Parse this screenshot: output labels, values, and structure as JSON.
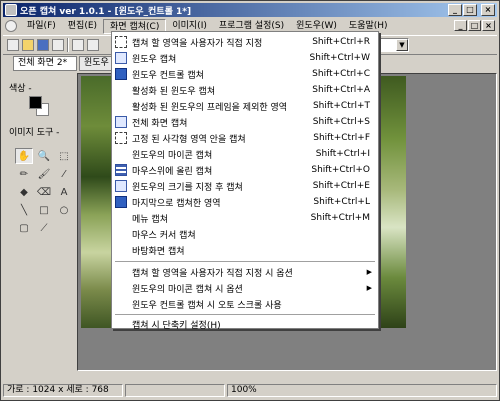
{
  "app": {
    "title": "오픈 캡쳐 ver 1.0.1 - [윈도우_컨트롤 1*]"
  },
  "window_buttons": [
    "_",
    "□",
    "×"
  ],
  "mdi_buttons": [
    "_",
    "□",
    "×"
  ],
  "menubar": {
    "items": [
      "파일(F)",
      "편집(E)",
      "화면 캡쳐(C)",
      "이미지(I)",
      "프로그램 설정(S)",
      "윈도우(W)",
      "도움말(H)"
    ],
    "active_index": 2
  },
  "tabs": [
    "전체 화면 2*",
    "윈도우 컨"
  ],
  "leftpanel": {
    "color_label": "색상 -",
    "tools_label": "이미지 도구 -"
  },
  "tools": [
    {
      "icon": "hand-icon",
      "glyph": "✋"
    },
    {
      "icon": "zoom-icon",
      "glyph": "🔍"
    },
    {
      "icon": "rect-select-icon",
      "glyph": "⬚"
    },
    {
      "icon": "pencil-icon",
      "glyph": "✏"
    },
    {
      "icon": "brush-icon",
      "glyph": "🖌"
    },
    {
      "icon": "eyedropper-icon",
      "glyph": "⁄"
    },
    {
      "icon": "fill-icon",
      "glyph": "◆"
    },
    {
      "icon": "eraser-icon",
      "glyph": "⌫"
    },
    {
      "icon": "text-icon",
      "glyph": "A"
    },
    {
      "icon": "line-icon",
      "glyph": "╲"
    },
    {
      "icon": "rectangle-icon",
      "glyph": "□"
    },
    {
      "icon": "ellipse-icon",
      "glyph": "○"
    },
    {
      "icon": "rounded-rect-icon",
      "glyph": "▢"
    },
    {
      "icon": "pen-icon",
      "glyph": "⟋"
    }
  ],
  "statusbar": {
    "size": "가로 : 1024 x 세로 : 768",
    "info": "",
    "zoom": "100%"
  },
  "dropdown": {
    "items": [
      {
        "label": "캡쳐 할 영역을 사용자가 직접 지정",
        "shortcut": "Shift+Ctrl+R",
        "icon": "area-select-icon"
      },
      {
        "label": "윈도우 캡쳐",
        "shortcut": "Shift+Ctrl+W",
        "icon": "window-capture-icon"
      },
      {
        "label": "윈도우 컨트롤 캡쳐",
        "shortcut": "Shift+Ctrl+C",
        "icon": "window-control-icon"
      },
      {
        "label": "활성화 된 윈도우 캡쳐",
        "shortcut": "Shift+Ctrl+A",
        "icon": ""
      },
      {
        "label": "활성화 된 윈도우의 프레임을 제외한 영역",
        "shortcut": "Shift+Ctrl+T",
        "icon": ""
      },
      {
        "label": "전체 화면 캡쳐",
        "shortcut": "Shift+Ctrl+S",
        "icon": "fullscreen-icon"
      },
      {
        "label": "고정 된 사각형 영역 안을 캡쳐",
        "shortcut": "Shift+Ctrl+F",
        "icon": "fixed-rect-icon"
      },
      {
        "label": "윈도우의 마이콘 캡쳐",
        "shortcut": "Shift+Ctrl+I",
        "icon": ""
      },
      {
        "label": "마우스위에 올린 캡쳐",
        "shortcut": "Shift+Ctrl+O",
        "icon": "mouse-over-icon"
      },
      {
        "label": "윈도우의 크기를 지정 후 캡쳐",
        "shortcut": "Shift+Ctrl+E",
        "icon": "resize-icon"
      },
      {
        "label": "마지막으로 캡쳐한 영역",
        "shortcut": "Shift+Ctrl+L",
        "icon": "last-area-icon"
      },
      {
        "label": "메뉴 캡쳐",
        "shortcut": "Shift+Ctrl+M",
        "icon": ""
      },
      {
        "label": "마우스 커서 캡쳐",
        "shortcut": "",
        "icon": ""
      },
      {
        "label": "바탕화면 캡쳐",
        "shortcut": "",
        "icon": ""
      },
      {
        "label": "캡쳐 할 영역을 사용자가 직접 지정 시 옵션",
        "shortcut": "",
        "icon": "",
        "submenu": true
      },
      {
        "label": "윈도우의 마이콘 캡쳐 시 옵션",
        "shortcut": "",
        "icon": "",
        "submenu": true
      },
      {
        "label": "윈도우 컨트롤 캡쳐 시 오토 스크롤 사용",
        "shortcut": "",
        "icon": ""
      },
      {
        "label": "캡쳐 시 단축키 설정(H)",
        "shortcut": "",
        "icon": ""
      }
    ],
    "submenu_glyph": "▶"
  }
}
